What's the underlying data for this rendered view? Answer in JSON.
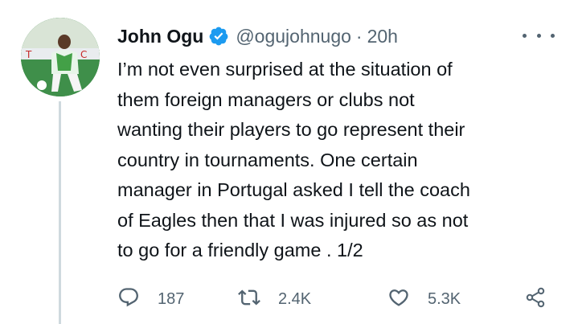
{
  "tweet": {
    "author": {
      "display_name": "John Ogu",
      "handle": "@ogujohnugo",
      "verified": true,
      "verified_color": "#1d9bf0"
    },
    "separator": "·",
    "time": "20h",
    "more_icon": "more-horizontal-icon",
    "body_lines": [
      "I’m not even surprised at the situation of",
      "them foreign managers or clubs not",
      "wanting their players to go represent their",
      "country in tournaments. One certain",
      "manager in Portugal asked I tell the coach",
      "of Eagles then that I was injured so as not",
      "to go for a friendly game . 1/2"
    ],
    "actions": {
      "reply": {
        "icon": "reply-icon",
        "count": "187"
      },
      "retweet": {
        "icon": "retweet-icon",
        "count": "2.4K"
      },
      "like": {
        "icon": "heart-icon",
        "count": "5.3K"
      },
      "share": {
        "icon": "share-icon"
      }
    }
  }
}
